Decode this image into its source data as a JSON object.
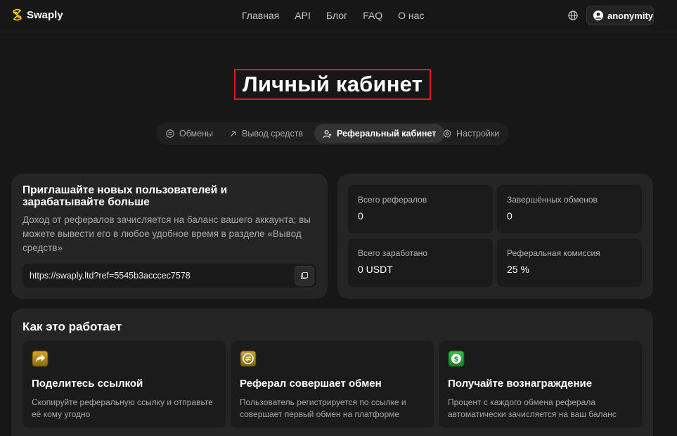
{
  "header": {
    "brand": "Swaply",
    "nav": [
      "Главная",
      "API",
      "Блог",
      "FAQ",
      "О нас"
    ],
    "user": "anonymity"
  },
  "page": {
    "title": "Личный кабинет"
  },
  "tabs": [
    {
      "label": "Обмены",
      "icon": "list-icon"
    },
    {
      "label": "Вывод средств",
      "icon": "arrow-up-right-icon"
    },
    {
      "label": "Реферальный кабинет",
      "icon": "user-plus-icon",
      "active": true
    },
    {
      "label": "Настройки",
      "icon": "gear-icon"
    }
  ],
  "invite": {
    "title": "Приглашайте новых пользователей и зарабатывайте больше",
    "description": "Доход от рефералов зачисляется на баланс вашего аккаунта; вы можете вывести его в любое удобное время в разделе «Вывод средств»",
    "link": "https://swaply.ltd?ref=5545b3acccec7578"
  },
  "stats": [
    {
      "label": "Всего рефералов",
      "value": "0"
    },
    {
      "label": "Завершённых обменов",
      "value": "0"
    },
    {
      "label": "Всего заработано",
      "value": "0 USDT"
    },
    {
      "label": "Реферальная комиссия",
      "value": "25 %"
    }
  ],
  "how": {
    "title": "Как это работает",
    "steps": [
      {
        "title": "Поделитесь ссылкой",
        "description": "Скопируйте реферальную ссылку и отправьте её кому угодно",
        "icon": "share-icon"
      },
      {
        "title": "Реферал совершает обмен",
        "description": "Пользователь регистрируется по ссылке и совершает первый обмен на платформе",
        "icon": "exchange-icon"
      },
      {
        "title": "Получайте вознаграждение",
        "description": "Процент с каждого обмена реферала автоматически зачисляется на ваш баланс",
        "icon": "dollar-icon"
      }
    ]
  },
  "colors": {
    "background": "#171717",
    "card": "#252525",
    "highlight": "#e01b1b",
    "brand": "#f5c518"
  }
}
